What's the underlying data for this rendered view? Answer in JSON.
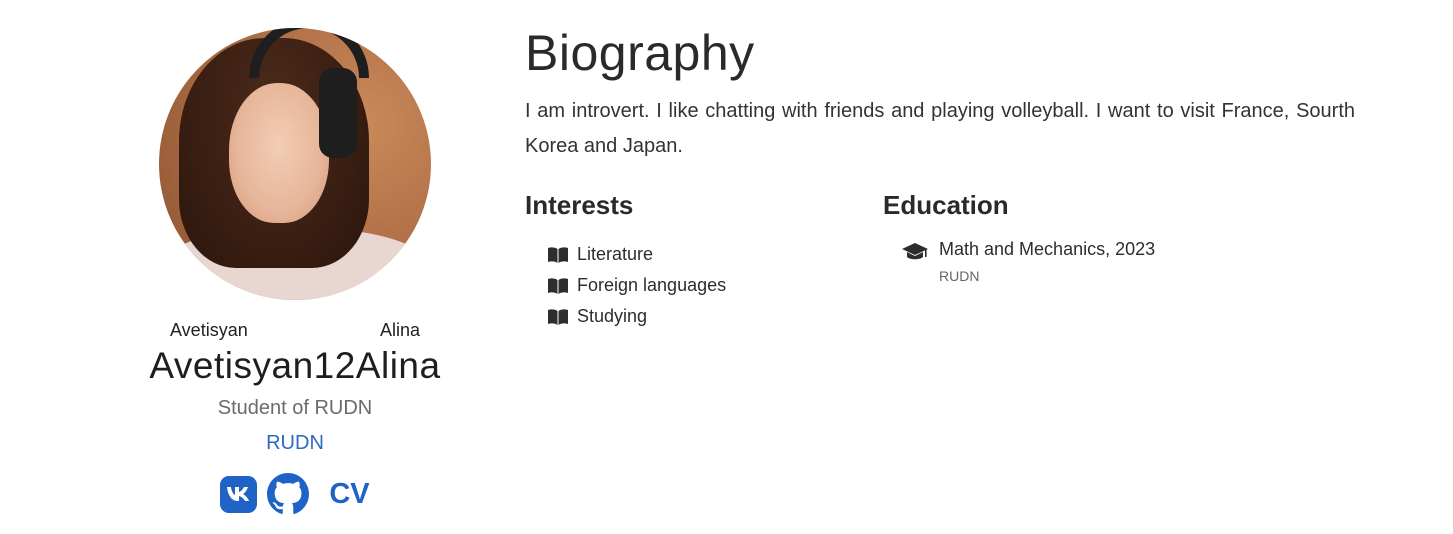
{
  "profile": {
    "avatar_alt": "avatar",
    "last_name": "Avetisyan",
    "first_name": "Alina",
    "username": "Avetisyan12Alina",
    "role": "Student of RUDN",
    "organization": "RUDN",
    "socials": {
      "vk_icon": "vk-icon",
      "vk_label": "vk",
      "github_icon": "github-icon",
      "cv_label": "CV"
    }
  },
  "biography": {
    "title": "Biography",
    "text": "I am introvert. I like chatting with friends and playing volleyball. I want to visit France, Sourth Korea and Japan."
  },
  "interests": {
    "title": "Interests",
    "icon": "book-icon",
    "items": [
      "Literature",
      "Foreign languages",
      "Studying"
    ]
  },
  "education": {
    "title": "Education",
    "icon": "graduation-cap-icon",
    "items": [
      {
        "degree": "Math and Mechanics, 2023",
        "institution": "RUDN"
      }
    ]
  },
  "colors": {
    "accent": "#1e63c5",
    "link": "#2c6ac0",
    "muted": "#6b6b6b"
  }
}
